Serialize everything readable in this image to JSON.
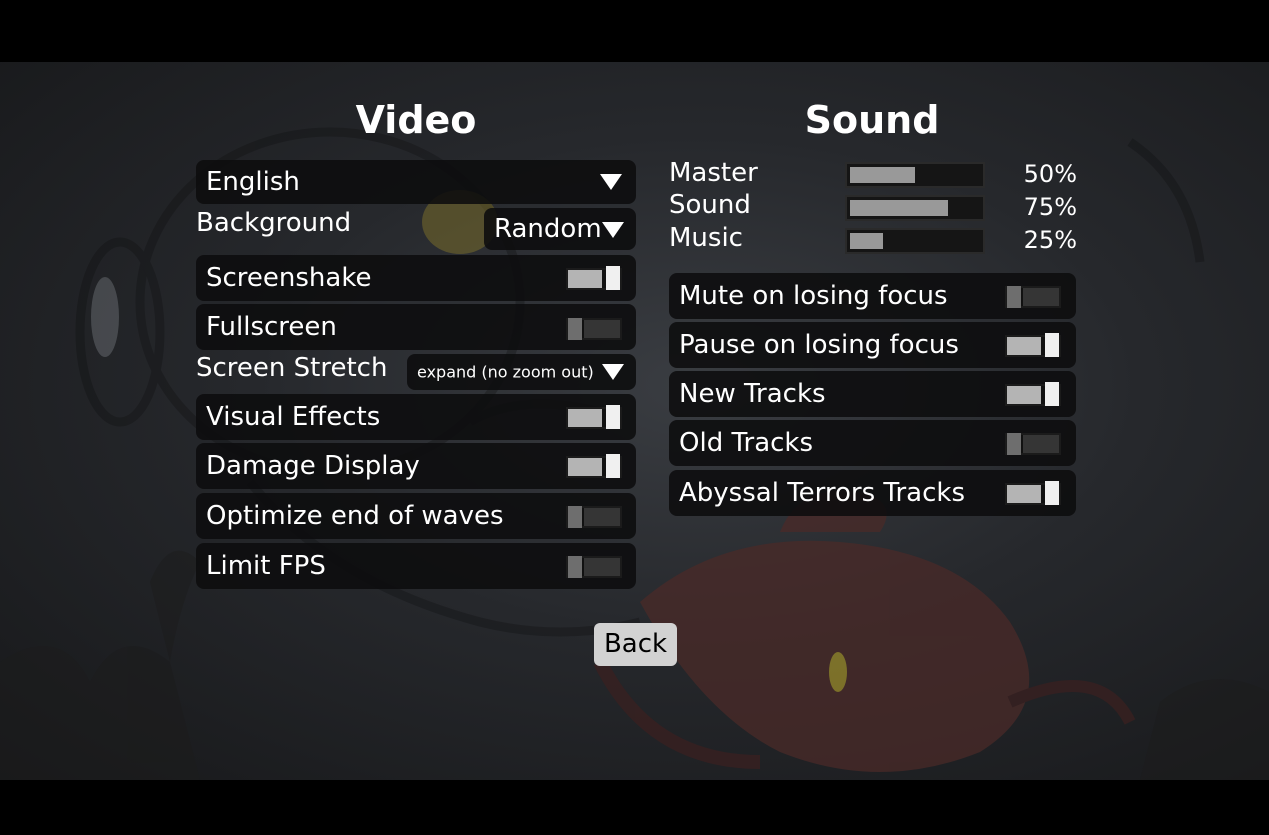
{
  "video": {
    "title": "Video",
    "language": {
      "value": "English"
    },
    "background": {
      "label": "Background",
      "value": "Random"
    },
    "screenshake": {
      "label": "Screenshake",
      "on": true
    },
    "fullscreen": {
      "label": "Fullscreen",
      "on": false
    },
    "screen_stretch": {
      "label": "Screen Stretch",
      "value": "expand (no zoom out)"
    },
    "visual_effects": {
      "label": "Visual Effects",
      "on": true
    },
    "damage_display": {
      "label": "Damage Display",
      "on": true
    },
    "optimize_end_of_waves": {
      "label": "Optimize end of waves",
      "on": false
    },
    "limit_fps": {
      "label": "Limit FPS",
      "on": false
    }
  },
  "sound": {
    "title": "Sound",
    "master": {
      "label": "Master",
      "percent": "50%",
      "level": 0.5
    },
    "sound": {
      "label": "Sound",
      "percent": "75%",
      "level": 0.75
    },
    "music": {
      "label": "Music",
      "percent": "25%",
      "level": 0.25
    },
    "mute_on_losing_focus": {
      "label": "Mute on losing focus",
      "on": false
    },
    "pause_on_losing_focus": {
      "label": "Pause on losing focus",
      "on": true
    },
    "new_tracks": {
      "label": "New Tracks",
      "on": true
    },
    "old_tracks": {
      "label": "Old Tracks",
      "on": false
    },
    "abyssal_terrors_tracks": {
      "label": "Abyssal Terrors Tracks",
      "on": true
    }
  },
  "back_button": {
    "label": "Back"
  }
}
